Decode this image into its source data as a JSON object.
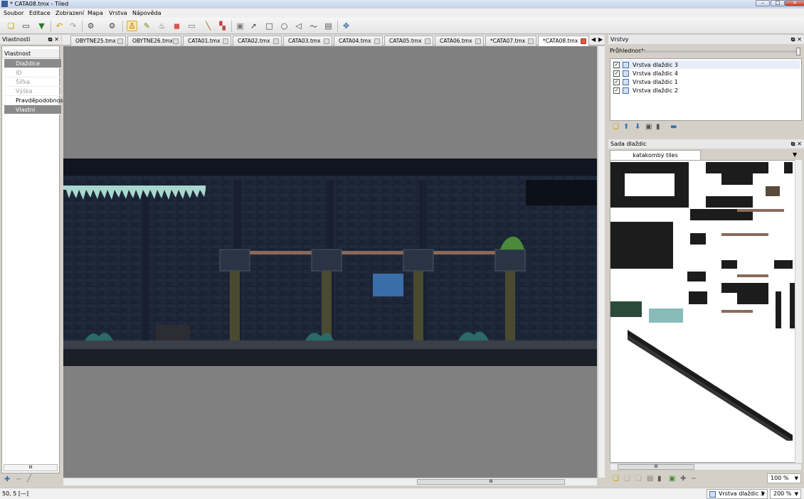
{
  "window": {
    "title": "* CATA08.tmx - Tiled",
    "minimize": "–",
    "maximize": "□",
    "close": "✕"
  },
  "menu": [
    "Soubor",
    "Editace",
    "Zobrazení",
    "Mapa",
    "Vrstva",
    "Nápověda"
  ],
  "toolbar": {
    "icons": [
      "new-file-icon",
      "open-folder-icon",
      "save-icon",
      "undo-icon",
      "redo-icon",
      "tiled-settings-icon",
      "tileset-icon",
      "stamp-brush-icon",
      "terrain-brush-icon",
      "bucket-fill-icon",
      "eraser-icon",
      "rectangle-select-icon",
      "magic-wand-icon",
      "select-same-tile-icon",
      "image-layer-icon",
      "select-objects-icon",
      "insert-rectangle-icon",
      "insert-ellipse-icon",
      "insert-polygon-icon",
      "insert-polyline-icon",
      "insert-tile-icon",
      "move-icon"
    ]
  },
  "properties_panel": {
    "title": "Vlastnosti",
    "header": "Vlastnost",
    "groups": [
      {
        "label": "Dlaždice",
        "items": [
          "ID",
          "Šířka",
          "Výška",
          "Pravděpodobnost"
        ]
      },
      {
        "label": "Vlastní vlastnosti",
        "items": []
      }
    ],
    "scroll_label": "III"
  },
  "tabs": [
    {
      "label": "OBYTNE25.tmx",
      "active": false
    },
    {
      "label": "OBYTNE26.tmx",
      "active": false
    },
    {
      "label": "CATA01.tmx",
      "active": false
    },
    {
      "label": "CATA02.tmx",
      "active": false
    },
    {
      "label": "CATA03.tmx",
      "active": false
    },
    {
      "label": "CATA04.tmx",
      "active": false
    },
    {
      "label": "CATA05.tmx",
      "active": false
    },
    {
      "label": "CATA06.tmx",
      "active": false
    },
    {
      "label": "*CATA07.tmx",
      "active": false
    },
    {
      "label": "*CATA08.tmx",
      "active": true
    }
  ],
  "layers_panel": {
    "title": "Vrstvy",
    "opacity_label": "Průhlednost:",
    "opacity": 1.0,
    "layers": [
      {
        "name": "Vrstva dlaždic 3",
        "visible": true,
        "selected": true
      },
      {
        "name": "Vrstva dlaždic 4",
        "visible": true,
        "selected": false
      },
      {
        "name": "Vrstva dlaždic 1",
        "visible": true,
        "selected": false
      },
      {
        "name": "Vrstva dlaždic 2",
        "visible": true,
        "selected": false
      }
    ]
  },
  "tileset_panel": {
    "title": "Sada dlaždic",
    "tab": "katakomby tiles",
    "zoom": "100 %",
    "scroll_label": "III"
  },
  "status": {
    "position": "50, 5 [—]",
    "current_layer": "Vrstva dlaždic 3",
    "zoom": "200 %",
    "hscroll_label": "III"
  },
  "colors": {
    "accent": "#fbe5a6",
    "scene_bg": "#141c2a",
    "canvas_bg": "#808080",
    "selected_tile": "#3a6ea8"
  }
}
